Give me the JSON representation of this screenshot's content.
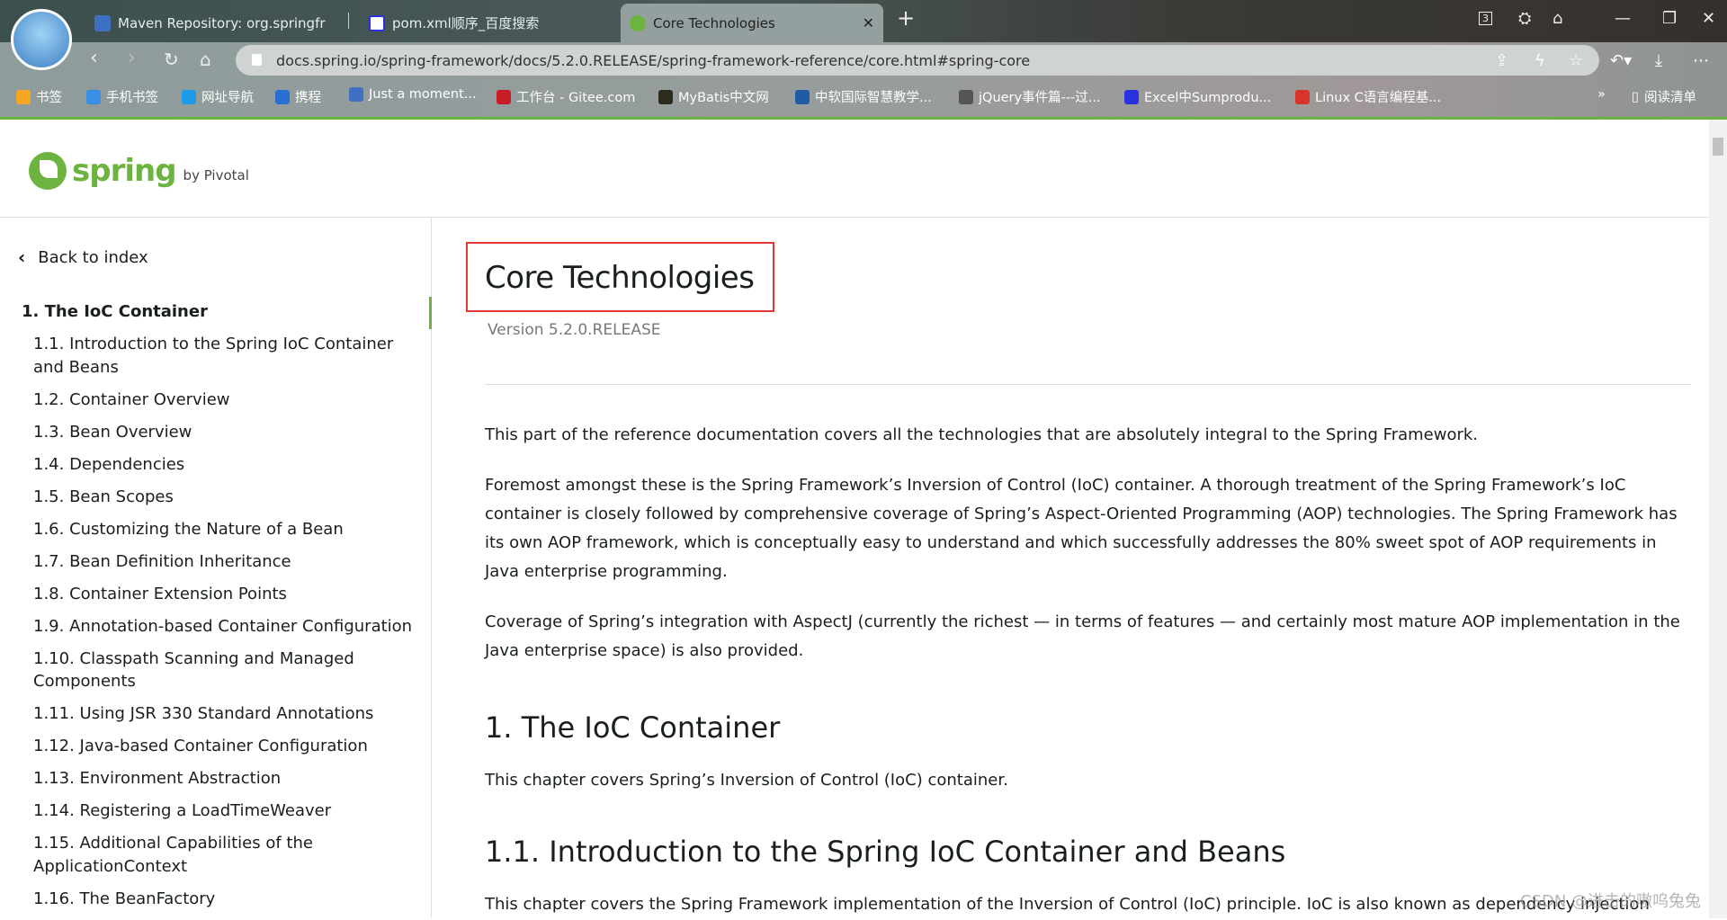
{
  "browser": {
    "tabs": [
      {
        "title": "Maven Repository: org.springfr",
        "icon": "mvn-icon"
      },
      {
        "title": "pom.xml顺序_百度搜索",
        "icon": "baidu-icon"
      },
      {
        "title": "Core Technologies",
        "icon": "spring-leaf-icon",
        "active": true
      }
    ],
    "url": "docs.spring.io/spring-framework/docs/5.2.0.RELEASE/spring-framework-reference/core.html#spring-core",
    "tab_count": "3",
    "bookmarks": [
      {
        "label": "书签",
        "color": "#f5a623"
      },
      {
        "label": "手机书签",
        "color": "#3a8ee6"
      },
      {
        "label": "网址导航",
        "color": "#1e9be8"
      },
      {
        "label": "携程",
        "color": "#2a6fd6"
      },
      {
        "label": "Just a moment...",
        "color": "#3f6fc0"
      },
      {
        "label": "工作台 - Gitee.com",
        "color": "#c71d23"
      },
      {
        "label": "MyBatis中文网",
        "color": "#2c2c1c"
      },
      {
        "label": "中软国际智慧教学...",
        "color": "#1f5aa6"
      },
      {
        "label": "jQuery事件篇---过...",
        "color": "#555"
      },
      {
        "label": "Excel中Sumprodu...",
        "color": "#2932e1"
      },
      {
        "label": "Linux C语言编程基...",
        "color": "#d9342b"
      }
    ],
    "more": "»",
    "reading_list": "阅读清单"
  },
  "header": {
    "logo_word": "spring",
    "logo_by": "by Pivotal"
  },
  "sidebar": {
    "back": "Back to index",
    "items": [
      "1. The IoC Container",
      "1.1. Introduction to the Spring IoC Container and Beans",
      "1.2. Container Overview",
      "1.3. Bean Overview",
      "1.4. Dependencies",
      "1.5. Bean Scopes",
      "1.6. Customizing the Nature of a Bean",
      "1.7. Bean Definition Inheritance",
      "1.8. Container Extension Points",
      "1.9. Annotation-based Container Configuration",
      "1.10. Classpath Scanning and Managed Components",
      "1.11. Using JSR 330 Standard Annotations",
      "1.12. Java-based Container Configuration",
      "1.13. Environment Abstraction",
      "1.14. Registering a LoadTimeWeaver",
      "1.15. Additional Capabilities of the ApplicationContext",
      "1.16. The BeanFactory"
    ]
  },
  "main": {
    "title": "Core Technologies",
    "version": "Version 5.2.0.RELEASE",
    "p1": "This part of the reference documentation covers all the technologies that are absolutely integral to the Spring Framework.",
    "p2": "Foremost amongst these is the Spring Framework’s Inversion of Control (IoC) container. A thorough treatment of the Spring Framework’s IoC container is closely followed by comprehensive coverage of Spring’s Aspect-Oriented Programming (AOP) technologies. The Spring Framework has its own AOP framework, which is conceptually easy to understand and which successfully addresses the 80% sweet spot of AOP requirements in Java enterprise programming.",
    "p3": "Coverage of Spring’s integration with AspectJ (currently the richest — in terms of features — and certainly most mature AOP implementation in the Java enterprise space) is also provided.",
    "h2_1": "1. The IoC Container",
    "p4": "This chapter covers Spring’s Inversion of Control (IoC) container.",
    "h2_2": "1.1. Introduction to the Spring IoC Container and Beans",
    "p5": "This chapter covers the Spring Framework implementation of the Inversion of Control (IoC) principle. IoC is also known as dependency injection"
  },
  "watermark": "CSDN @进击的嗷呜兔兔",
  "colors": {
    "accent": "#6db33f",
    "highlight_box": "#e53935"
  }
}
